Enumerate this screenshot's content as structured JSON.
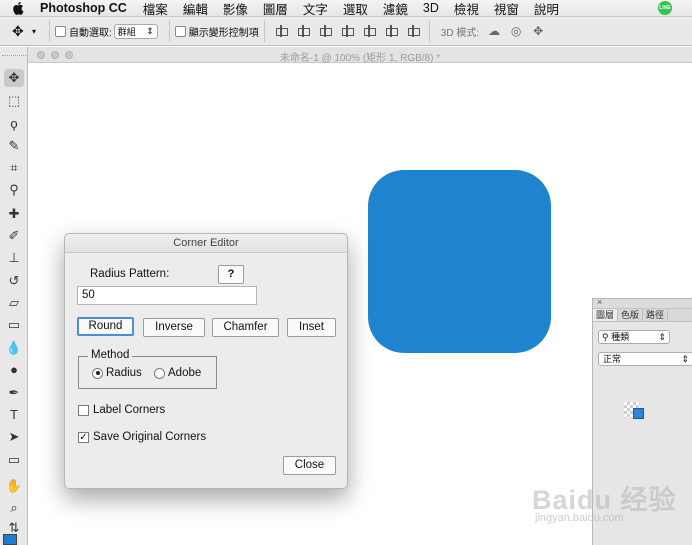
{
  "menubar": {
    "app_name": "Photoshop CC",
    "items": [
      "檔案",
      "編輯",
      "影像",
      "圖層",
      "文字",
      "選取",
      "濾鏡",
      "3D",
      "檢視",
      "視窗",
      "說明"
    ],
    "line_icon_text": "LINE"
  },
  "options_bar": {
    "auto_select_label": "自動選取:",
    "auto_select_value": "群組",
    "show_transform_label": "顯示變形控制項",
    "mode_3d_label": "3D 模式:"
  },
  "document": {
    "title": "未命名-1 @ 100% (矩形 1, RGB/8) *"
  },
  "canvas": {
    "shape_color": "#1f84cf"
  },
  "dialog": {
    "title": "Corner Editor",
    "radius_pattern_label": "Radius Pattern:",
    "help_button": "?",
    "radius_value": "50",
    "buttons": {
      "round": "Round",
      "inverse": "Inverse",
      "chamfer": "Chamfer",
      "inset": "Inset"
    },
    "method": {
      "legend": "Method",
      "options": [
        "Radius",
        "Adobe"
      ],
      "selected": "Radius"
    },
    "label_corners": {
      "label": "Label Corners",
      "checked": false
    },
    "save_original": {
      "label": "Save Original Corners",
      "checked": true
    },
    "close_button": "Close"
  },
  "layers_panel": {
    "close_glyph": "×",
    "tabs": [
      "圖層",
      "色版",
      "路徑"
    ],
    "filter_label": "種類",
    "blend_mode": "正常"
  },
  "watermark": {
    "brand": "Baidu 经验",
    "url": "jingyan.baidu.com"
  }
}
